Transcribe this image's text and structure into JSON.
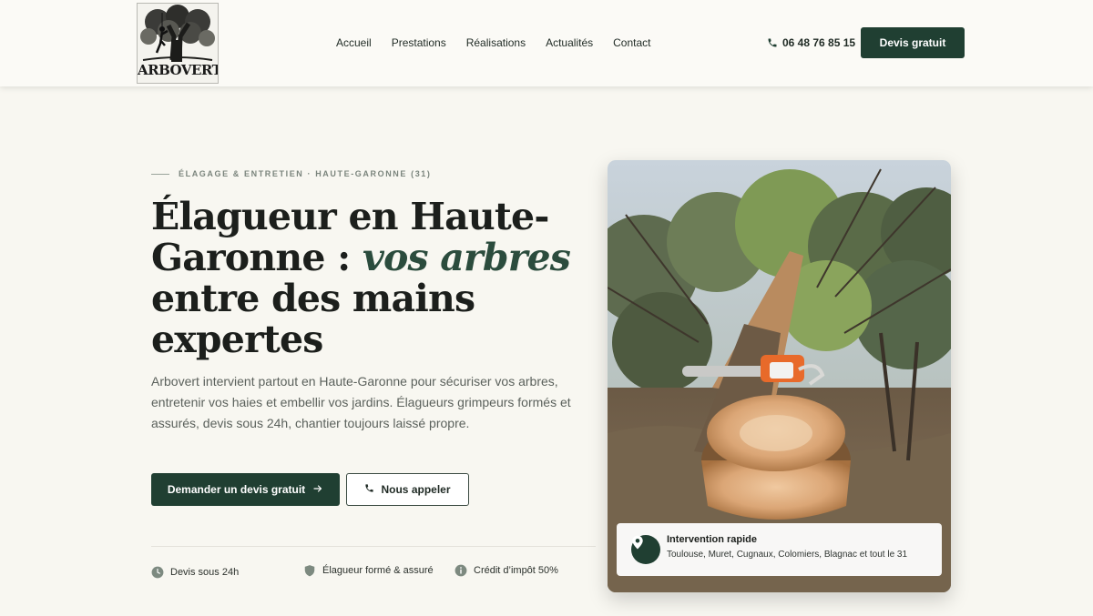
{
  "brand": {
    "logo_text": "ARBOVERT"
  },
  "nav": {
    "items": [
      "Accueil",
      "Prestations",
      "Réalisations",
      "Actualités",
      "Contact"
    ]
  },
  "header": {
    "phone": "06 48 76 85 15",
    "cta_label": "Devis gratuit"
  },
  "hero": {
    "eyebrow": "ÉLAGAGE & ENTRETIEN · HAUTE-GARONNE (31)",
    "title_part1": "Élagueur en Haute-Garonne :",
    "title_emphasis": "vos arbres",
    "title_part2": "entre des mains expertes",
    "lead": "Arbovert intervient partout en Haute-Garonne pour sécuriser vos arbres, entretenir vos haies et embellir vos jardins. Élagueurs grimpeurs formés et assurés, devis sous 24h, chantier toujours laissé propre.",
    "primary_button": "Demander un devis gratuit",
    "secondary_button": "Nous appeler",
    "features": [
      "Devis sous 24h",
      "Élagueur formé & assuré",
      "Crédit d’impôt 50%"
    ]
  },
  "photo_badge": {
    "title": "Intervention rapide",
    "subtitle": "Toulouse, Muret, Cugnaux, Colomiers, Blagnac et tout le 31"
  },
  "colors": {
    "accent": "#203f32",
    "background": "#f8f7f1",
    "emphasis_text": "#2b4c3d"
  },
  "icons": {
    "phone": "phone-icon",
    "arrow": "arrow-right-icon",
    "clock": "clock-icon",
    "shield": "shield-icon",
    "info": "info-icon",
    "location": "location-pin-icon"
  }
}
